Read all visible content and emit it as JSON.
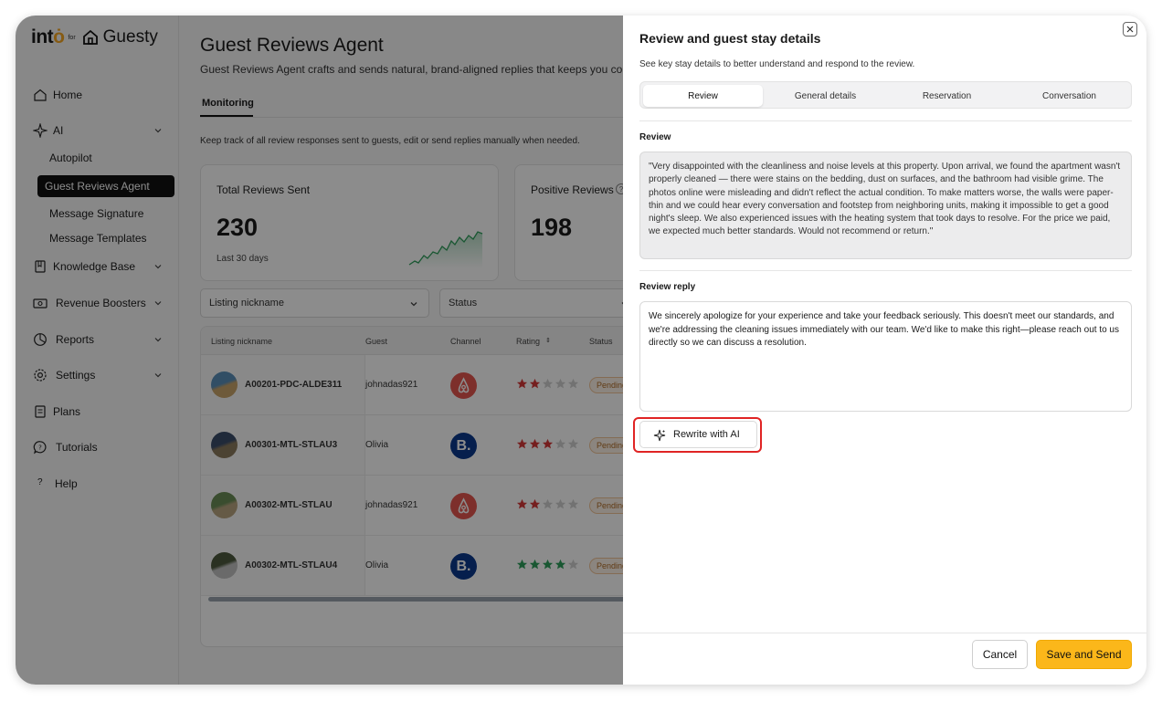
{
  "app": {
    "brand_into": "int",
    "brand_for": "for",
    "brand_guesty": "Guesty",
    "accent_color": "#fbb71a"
  },
  "sidebar": {
    "items": [
      {
        "label": "Home",
        "icon": "home-icon"
      },
      {
        "label": "AI",
        "icon": "sparkles-icon"
      },
      {
        "label": "Knowledge Base",
        "icon": "book-icon"
      },
      {
        "label": "Revenue Boosters",
        "icon": "cash-icon"
      },
      {
        "label": "Reports",
        "icon": "pie-chart-icon"
      },
      {
        "label": "Settings",
        "icon": "gear-icon"
      },
      {
        "label": "Plans",
        "icon": "document-icon"
      },
      {
        "label": "Tutorials",
        "icon": "question-bubble-icon"
      },
      {
        "label": "Help",
        "icon": "question-icon"
      }
    ],
    "ai_subitems": [
      {
        "label": "Autopilot"
      },
      {
        "label": "Guest Reviews Agent",
        "active": true
      },
      {
        "label": "Message Signature"
      },
      {
        "label": "Message Templates"
      }
    ]
  },
  "main": {
    "title": "Guest Reviews Agent",
    "subtitle": "Guest Reviews Agent crafts and sends natural, brand-aligned replies that keeps you conn",
    "tab": "Monitoring",
    "description": "Keep track of all review responses sent to guests, edit or send replies manually when needed.",
    "cards": [
      {
        "title": "Total Reviews Sent",
        "value": "230",
        "sub": "Last 30 days"
      },
      {
        "title": "Positive Reviews",
        "value": "198"
      }
    ],
    "filters": [
      {
        "placeholder": "Listing nickname"
      },
      {
        "placeholder": "Status"
      }
    ],
    "table": {
      "headers": [
        "Listing nickname",
        "Guest",
        "Channel",
        "Rating",
        "Status"
      ],
      "rows": [
        {
          "listing": "A00201-PDC-ALDE311",
          "guest": "johnadas921",
          "channel": "airbnb",
          "rating": 2,
          "status": "Pending"
        },
        {
          "listing": "A00301-MTL-STLAU3",
          "guest": "Olivia",
          "channel": "booking",
          "rating": 3,
          "status": "Pending"
        },
        {
          "listing": "A00302-MTL-STLAU",
          "guest": "johnadas921",
          "channel": "airbnb",
          "rating": 2,
          "status": "Pending"
        },
        {
          "listing": "A00302-MTL-STLAU4",
          "guest": "Olivia",
          "channel": "booking",
          "rating": 4,
          "status": "Pending"
        }
      ]
    }
  },
  "panel": {
    "title": "Review and guest stay details",
    "subtitle": "See key stay details to better understand and respond to the review.",
    "tabs": [
      "Review",
      "General details",
      "Reservation",
      "Conversation"
    ],
    "active_tab": "Review",
    "review_label": "Review",
    "review_text": "\"Very disappointed with the cleanliness and noise levels at this property. Upon arrival, we found the apartment wasn't properly cleaned — there were stains on the bedding, dust on surfaces, and the bathroom had visible grime. The photos online were misleading and didn't reflect the actual condition. To make matters worse, the walls were paper-thin and we could hear every conversation and footstep from neighboring units, making it impossible to get a good night's sleep. We also experienced issues with the heating system that took days to resolve. For the price we paid, we expected much better standards. Would not recommend or return.\"",
    "reply_label": "Review reply",
    "reply_text": "We sincerely apologize for your experience and take your feedback seriously. This doesn't meet our standards, and we're addressing the cleaning issues immediately with our team. We'd like to make this right—please reach out to us directly so we can discuss a resolution.",
    "rewrite_label": "Rewrite with AI",
    "cancel_label": "Cancel",
    "save_label": "Save and Send"
  }
}
